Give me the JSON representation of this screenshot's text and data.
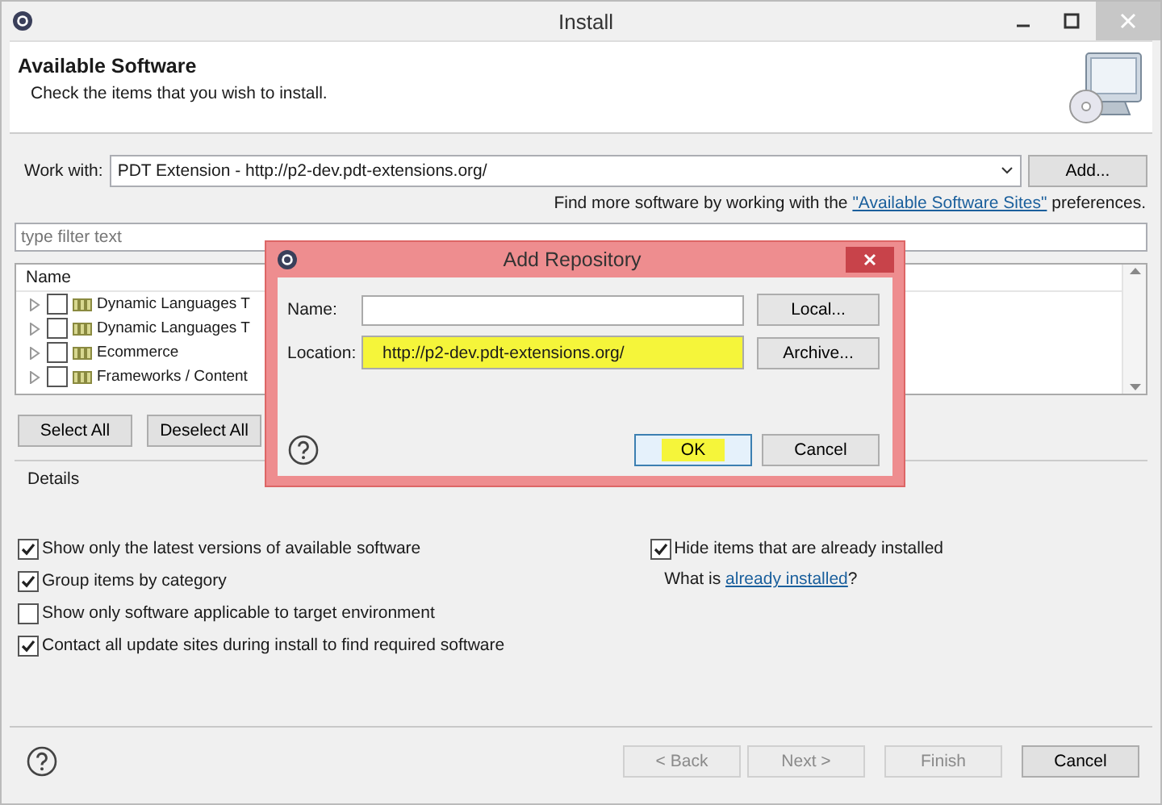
{
  "window": {
    "title": "Install"
  },
  "header": {
    "title": "Available Software",
    "subtitle": "Check the items that you wish to install."
  },
  "work_with": {
    "label": "Work with:",
    "value": "PDT Extension - http://p2-dev.pdt-extensions.org/",
    "button": "Add..."
  },
  "find_more": {
    "before": "Find more software by working with the",
    "link": "\"Available Software Sites\"",
    "after": "preferences."
  },
  "filter": {
    "placeholder": "type filter text"
  },
  "tree": {
    "column": "Name",
    "items": [
      {
        "label": "Dynamic Languages T",
        "checked": false,
        "expanded": false
      },
      {
        "label": "Dynamic Languages T",
        "checked": false,
        "expanded": false
      },
      {
        "label": "Ecommerce",
        "checked": false,
        "expanded": false
      },
      {
        "label": "Frameworks / Content",
        "checked": false,
        "expanded": false
      }
    ]
  },
  "selection_buttons": [
    "Select All",
    "Deselect All"
  ],
  "details": {
    "title": "Details"
  },
  "options": [
    {
      "label": "Show only the latest versions of available software",
      "checked": true
    },
    {
      "label": "Group items by category",
      "checked": true
    },
    {
      "label": "Show only software applicable to target environment",
      "checked": false
    },
    {
      "label": "Contact all update sites during install to find required software",
      "checked": true
    }
  ],
  "hide_installed": {
    "label": "Hide items that are already installed",
    "checked": true
  },
  "what_is": {
    "before": "What is",
    "link": "already installed",
    "after": "?"
  },
  "footer_buttons": [
    {
      "label": "< Back",
      "disabled": true
    },
    {
      "label": "Next >",
      "disabled": true
    },
    {
      "label": "Finish",
      "disabled": true
    },
    {
      "label": "Cancel",
      "disabled": false
    }
  ],
  "dialog": {
    "title": "Add Repository",
    "name_label": "Name:",
    "location_label": "Location:",
    "location_value": "http://p2-dev.pdt-extensions.org/",
    "location_highlighted": true,
    "side_buttons": [
      "Local...",
      "Archive..."
    ],
    "buttons": [
      {
        "label": "OK",
        "highlighted": true,
        "default": true
      },
      {
        "label": "Cancel",
        "highlighted": false,
        "default": false
      }
    ]
  }
}
